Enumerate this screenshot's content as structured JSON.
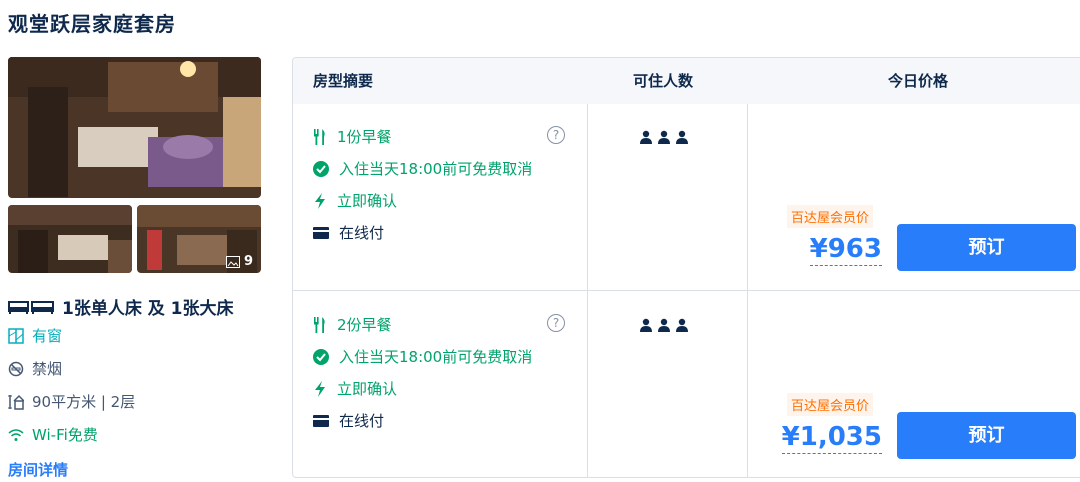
{
  "room": {
    "title": "观堂跃层家庭套房",
    "photo_count": "9",
    "bed": "1张单人床 及 1张大床",
    "facilities": [
      {
        "icon": "window-icon",
        "label": "有窗"
      },
      {
        "icon": "no-smoking-icon",
        "label": "禁烟"
      },
      {
        "icon": "area-icon",
        "label": "90平方米 | 2层"
      },
      {
        "icon": "wifi-icon",
        "label": "Wi-Fi免费"
      }
    ],
    "details_link": "房间详情"
  },
  "table": {
    "headers": {
      "summary": "房型摘要",
      "guests": "可住人数",
      "price": "今日价格"
    },
    "rows": [
      {
        "breakfast": "1份早餐",
        "cancel": "入住当天18:00前可免费取消",
        "confirm": "立即确认",
        "payment": "在线付",
        "member_tag": "百达屋会员价",
        "price": "¥963",
        "book": "预订"
      },
      {
        "breakfast": "2份早餐",
        "cancel": "入住当天18:00前可免费取消",
        "confirm": "立即确认",
        "payment": "在线付",
        "member_tag": "百达屋会员价",
        "price": "¥1,035",
        "book": "预订"
      }
    ]
  },
  "colors": {
    "accent": "#287dfa",
    "green": "#00a36a",
    "orange": "#ff6f00",
    "text": "#0f294d"
  }
}
